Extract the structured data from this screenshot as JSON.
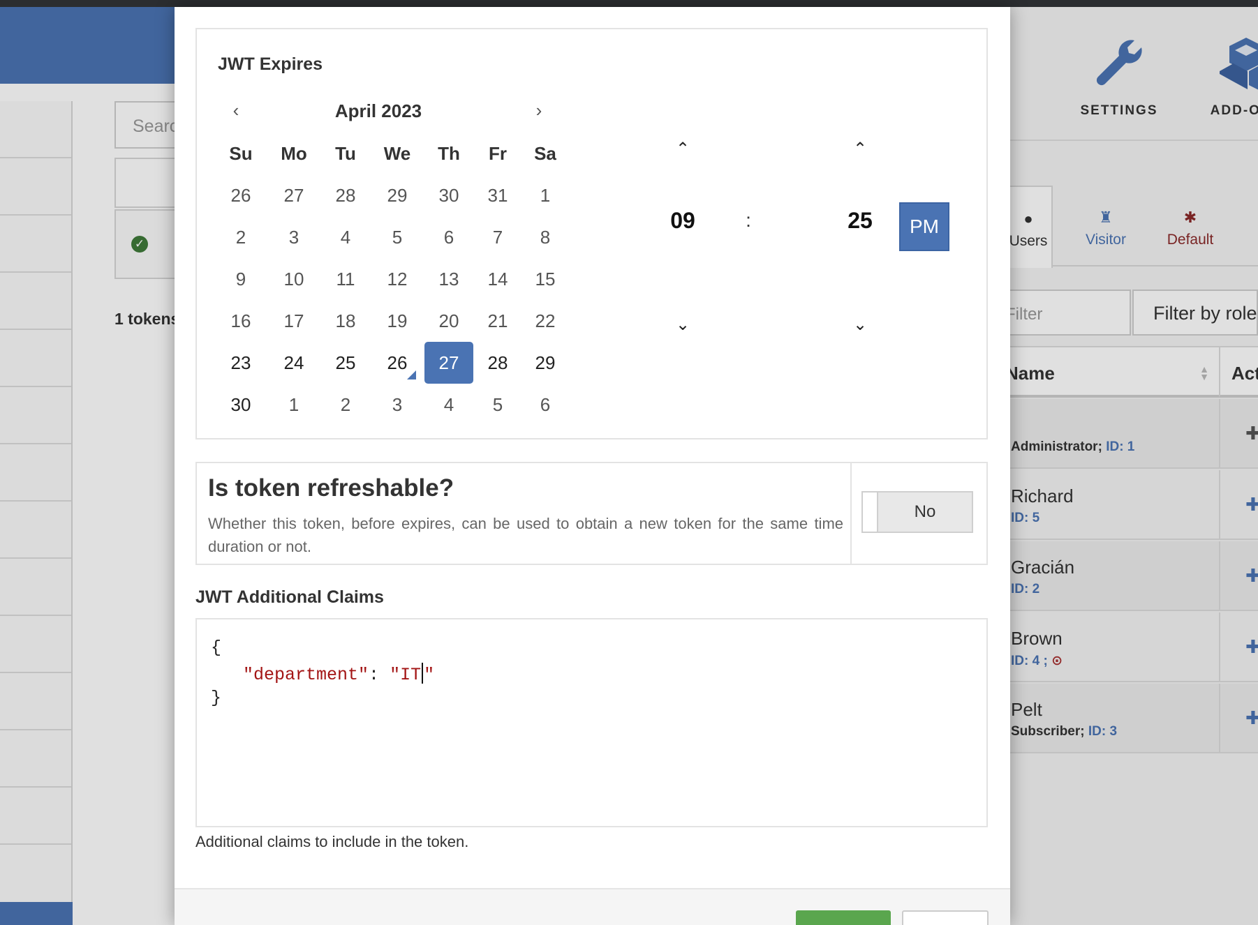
{
  "background": {
    "search_placeholder": "Search",
    "token_count": "1 tokens",
    "nav": {
      "settings": "SETTINGS",
      "addons": "ADD-ONS"
    },
    "role_tabs": [
      {
        "label": "Users",
        "icon": "user-icon"
      },
      {
        "label": "Visitor",
        "icon": "visitor-icon"
      },
      {
        "label": "Default",
        "icon": "asterisk-icon"
      }
    ],
    "filter_placeholder": "Filter",
    "filter_role": "Filter by role",
    "table": {
      "col_name": "Name",
      "col_actions": "Actions",
      "rows": [
        {
          "name": "",
          "role": "Administrator;",
          "id": "ID: 1"
        },
        {
          "name": "Richard",
          "role": "",
          "id": "ID: 5"
        },
        {
          "name": "Gracián",
          "role": "",
          "id": "ID: 2"
        },
        {
          "name": "Brown",
          "role": "",
          "id": "ID: 4 ;"
        },
        {
          "name": "Pelt",
          "role": "Subscriber;",
          "id": "ID: 3"
        }
      ]
    }
  },
  "modal": {
    "expires_title": "JWT Expires",
    "calendar": {
      "month_label": "April 2023",
      "weekdays": [
        "Su",
        "Mo",
        "Tu",
        "We",
        "Th",
        "Fr",
        "Sa"
      ],
      "weeks": [
        [
          "26",
          "27",
          "28",
          "29",
          "30",
          "31",
          "1"
        ],
        [
          "2",
          "3",
          "4",
          "5",
          "6",
          "7",
          "8"
        ],
        [
          "9",
          "10",
          "11",
          "12",
          "13",
          "14",
          "15"
        ],
        [
          "16",
          "17",
          "18",
          "19",
          "20",
          "21",
          "22"
        ],
        [
          "23",
          "24",
          "25",
          "26",
          "27",
          "28",
          "29"
        ],
        [
          "30",
          "1",
          "2",
          "3",
          "4",
          "5",
          "6"
        ]
      ],
      "selected_day": "27",
      "today_day": "26"
    },
    "time": {
      "hour": "09",
      "separator": ":",
      "minute": "25",
      "ampm": "PM"
    },
    "refreshable": {
      "title": "Is token refreshable?",
      "description": "Whether this token, before expires, can be used to obtain a new token for the same time duration or not.",
      "toggle_label": "No"
    },
    "claims": {
      "title": "JWT Additional Claims",
      "open_brace": "{",
      "key": "\"department\"",
      "colon": ":",
      "value_before_caret": "\"IT",
      "value_after_caret": "\"",
      "close_brace": "}",
      "help": "Additional claims to include in the token."
    }
  },
  "colors": {
    "accent": "#4a73b3",
    "success": "#5aa64e",
    "code_string": "#a31515",
    "default_role": "#8a2a2a"
  }
}
